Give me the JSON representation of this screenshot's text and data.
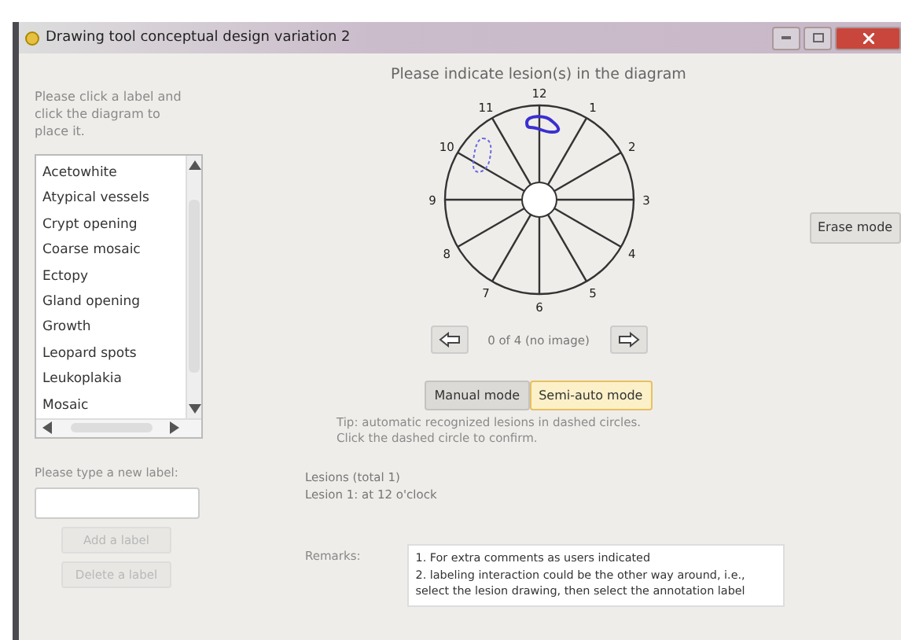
{
  "window": {
    "title": "Drawing tool conceptual design variation 2"
  },
  "sidebar": {
    "instruction": "Please click a label and click the diagram to place it.",
    "labels": [
      {
        "label": "Acetowhite",
        "selected": false
      },
      {
        "label": "Atypical vessels",
        "selected": false
      },
      {
        "label": "Crypt opening",
        "selected": false
      },
      {
        "label": "Coarse mosaic",
        "selected": false
      },
      {
        "label": "Ectopy",
        "selected": false
      },
      {
        "label": "Gland opening",
        "selected": false
      },
      {
        "label": "Growth",
        "selected": false
      },
      {
        "label": "Leopard spots",
        "selected": false
      },
      {
        "label": "Leukoplakia",
        "selected": false
      },
      {
        "label": "Mosaic",
        "selected": false
      }
    ],
    "new_label_prompt": "Please type a new label:",
    "buttons": [
      {
        "label": "Add a label",
        "disabled": true
      },
      {
        "label": "Delete a label",
        "disabled": true
      }
    ]
  },
  "diagram": {
    "title": "Please indicate lesion(s) in the diagram",
    "clock_labels": [
      "12",
      "1",
      "2",
      "3",
      "4",
      "5",
      "6",
      "7",
      "8",
      "9",
      "10",
      "11"
    ],
    "lesions": [
      {
        "kind": "confirmed"
      },
      {
        "kind": "suggested"
      }
    ]
  },
  "navigation": {
    "counter": "0 of 4 (no image)"
  },
  "erase_button": "Erase mode",
  "modes": [
    {
      "label": "Manual mode",
      "selected": false
    },
    {
      "label": "Semi-auto mode",
      "selected": true
    }
  ],
  "tip": [
    "Tip: automatic recognized lesions in dashed circles.",
    "Click the dashed circle to confirm."
  ],
  "lesion_summary": [
    "Lesions (total 1)",
    "Lesion 1: at 12 o'clock"
  ],
  "remarks": {
    "label": "Remarks:",
    "lines": [
      "1. For extra comments as users indicated",
      "2. labeling interaction could be the other way around, i.e.,",
      "select the lesion drawing, then select the annotation label"
    ]
  }
}
